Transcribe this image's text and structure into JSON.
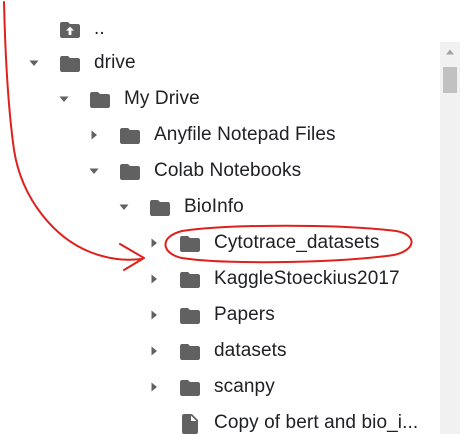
{
  "file_tree": {
    "items": [
      {
        "label": "..",
        "icon": "folder-up-icon",
        "toggle": "none"
      },
      {
        "label": "drive",
        "icon": "folder-icon",
        "toggle": "expanded"
      },
      {
        "label": "My Drive",
        "icon": "folder-icon",
        "toggle": "expanded"
      },
      {
        "label": "Anyfile Notepad Files",
        "icon": "folder-icon",
        "toggle": "collapsed"
      },
      {
        "label": "Colab Notebooks",
        "icon": "folder-icon",
        "toggle": "expanded"
      },
      {
        "label": "BioInfo",
        "icon": "folder-icon",
        "toggle": "expanded"
      },
      {
        "label": "Cytotrace_datasets",
        "icon": "folder-icon",
        "toggle": "collapsed"
      },
      {
        "label": "KaggleStoeckius2017",
        "icon": "folder-icon",
        "toggle": "collapsed"
      },
      {
        "label": "Papers",
        "icon": "folder-icon",
        "toggle": "collapsed"
      },
      {
        "label": "datasets",
        "icon": "folder-icon",
        "toggle": "collapsed"
      },
      {
        "label": "scanpy",
        "icon": "folder-icon",
        "toggle": "collapsed"
      },
      {
        "label": "Copy of bert and bio_i...",
        "icon": "file-icon",
        "toggle": "none"
      }
    ]
  },
  "annotation": {
    "color": "#e0201c",
    "target": "Cytotrace_datasets"
  },
  "colors": {
    "icon": "#616161",
    "text": "#202124",
    "scrollbar_track": "#f1f1f1",
    "scrollbar_thumb": "#c1c1c1"
  }
}
